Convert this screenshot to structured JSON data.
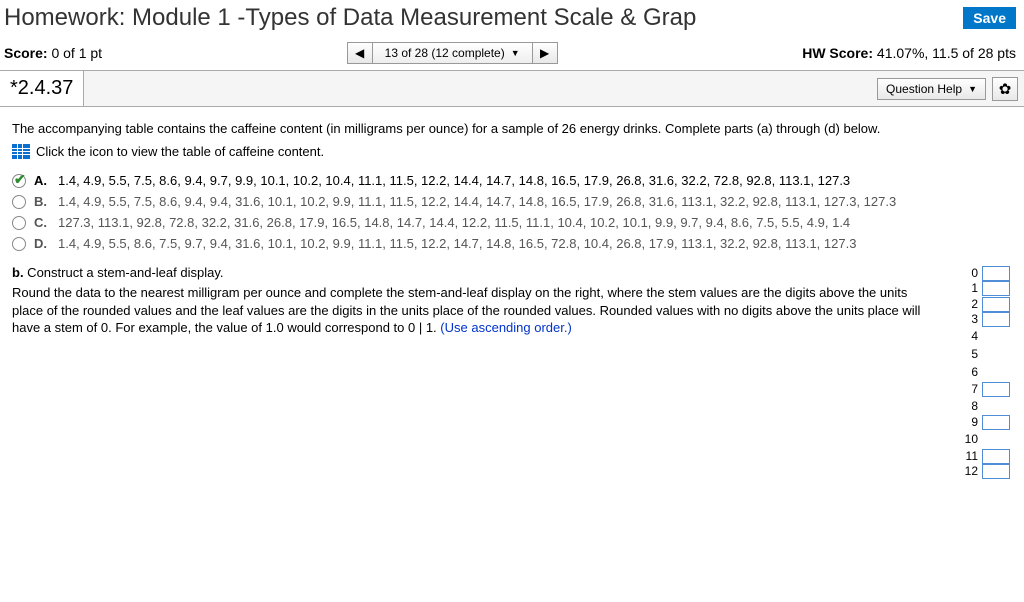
{
  "header": {
    "title": "Homework: Module 1 -Types of Data Measurement Scale & Grap",
    "save_label": "Save"
  },
  "score_bar": {
    "left_label": "Score:",
    "left_value": "0 of 1 pt",
    "nav_status": "13 of 28 (12 complete)",
    "right_label": "HW Score:",
    "right_value": "41.07%, 11.5 of 28 pts"
  },
  "question_bar": {
    "question_id": "*2.4.37",
    "help_label": "Question Help"
  },
  "prompt": "The accompanying table contains the caffeine content (in milligrams per ounce) for a sample of 26 energy drinks. Complete parts (a) through (d) below.",
  "icon_link": "Click the icon to view the table of caffeine content.",
  "options": [
    {
      "letter": "A.",
      "selected": true,
      "values": "1.4, 4.9, 5.5, 7.5, 8.6, 9.4, 9.7, 9.9, 10.1, 10.2, 10.4, 11.1, 11.5, 12.2, 14.4, 14.7, 14.8, 16.5, 17.9, 26.8, 31.6, 32.2, 72.8, 92.8, 113.1, 127.3"
    },
    {
      "letter": "B.",
      "selected": false,
      "values": "1.4, 4.9, 5.5, 7.5, 8.6, 9.4, 9.4, 31.6, 10.1, 10.2, 9.9, 11.1, 11.5, 12.2, 14.4, 14.7, 14.8, 16.5, 17.9, 26.8, 31.6, 113.1, 32.2, 92.8, 113.1, 127.3, 127.3"
    },
    {
      "letter": "C.",
      "selected": false,
      "values": "127.3, 113.1, 92.8, 72.8, 32.2, 31.6, 26.8, 17.9, 16.5, 14.8, 14.7, 14.4, 12.2, 11.5, 11.1, 10.4, 10.2, 10.1, 9.9, 9.7, 9.4, 8.6, 7.5, 5.5, 4.9, 1.4"
    },
    {
      "letter": "D.",
      "selected": false,
      "values": "1.4, 4.9, 5.5, 8.6, 7.5, 9.7, 9.4, 31.6, 10.1, 10.2, 9.9, 11.1, 11.5, 12.2, 14.7, 14.8, 16.5, 72.8, 10.4, 26.8, 17.9, 113.1, 32.2, 92.8, 113.1, 127.3"
    }
  ],
  "part_b": {
    "heading_bold": "b.",
    "heading_rest": " Construct a stem-and-leaf display.",
    "body": "Round the data to the nearest milligram per ounce and complete the stem-and-leaf display on the right, where the stem values are the digits above the units place of the rounded values and the leaf values are the digits in the units place of the rounded values. Rounded values with no digits above the units place will have a stem of 0. For example, the value of 1.0 would correspond to 0 | 1. ",
    "hint": "(Use ascending order.)"
  },
  "stem_leaf": {
    "stems": [
      "0",
      "1",
      "2",
      "3",
      "4",
      "5",
      "6",
      "7",
      "8",
      "9",
      "10",
      "11",
      "12"
    ],
    "inputs_at": [
      0,
      1,
      2,
      3,
      7,
      9,
      11,
      12
    ]
  }
}
